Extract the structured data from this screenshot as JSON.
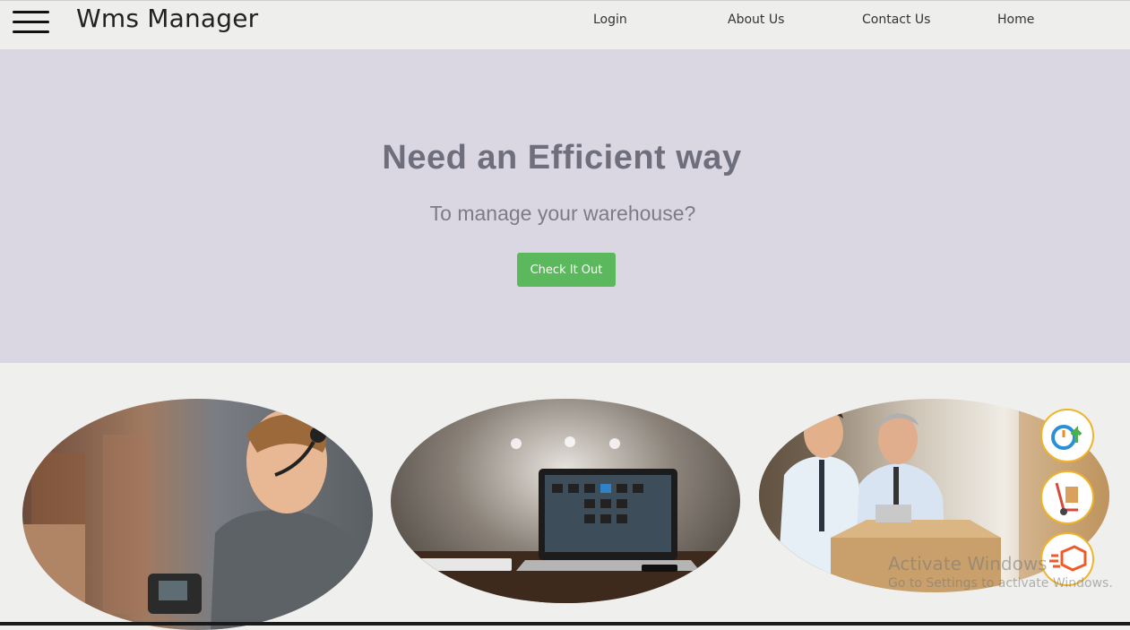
{
  "header": {
    "brand": "Wms Manager",
    "nav": [
      "Login",
      "About Us",
      "Contact Us",
      "Home"
    ]
  },
  "hero": {
    "title": "Need an Efficient way",
    "subtitle": "To manage your warehouse?",
    "cta_label": "Check It Out"
  },
  "gallery": {
    "images": [
      "warehouse-worker-scanner",
      "laptop-warehouse-software",
      "warehouse-managers-boxes"
    ]
  },
  "side_icons": [
    "timer-upload-icon",
    "hand-truck-icon",
    "fast-delivery-box-icon"
  ],
  "watermark": {
    "line1": "Activate Windows",
    "line2": "Go to Settings to activate Windows."
  },
  "colors": {
    "hero_bg": "#dad7e3",
    "cta_bg": "#5cb85c",
    "icon_ring": "#f0b429"
  }
}
